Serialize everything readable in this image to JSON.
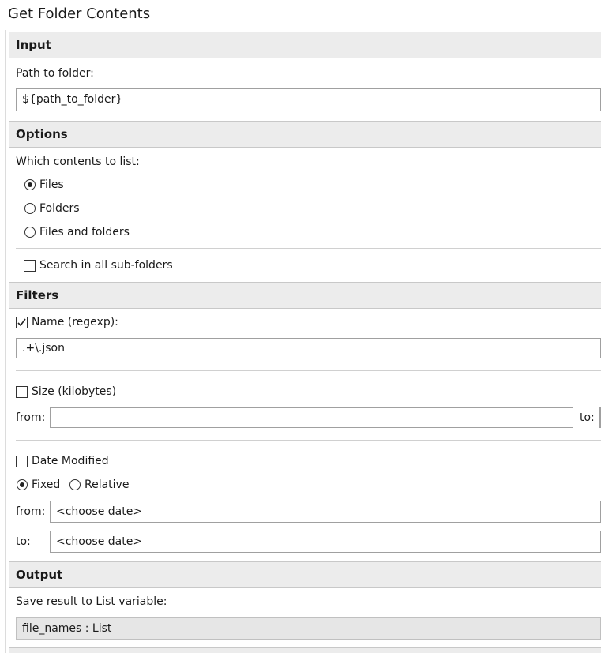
{
  "title": "Get Folder Contents",
  "input": {
    "header": "Input",
    "path_label": "Path to folder:",
    "path_value": "${path_to_folder}"
  },
  "options": {
    "header": "Options",
    "contents_label": "Which contents to list:",
    "radio_files": "Files",
    "radio_folders": "Folders",
    "radio_both": "Files and folders",
    "selected": "Files",
    "subfolders_label": "Search in all sub-folders",
    "subfolders_checked": false
  },
  "filters": {
    "header": "Filters",
    "name_label": "Name (regexp):",
    "name_checked": true,
    "name_value": ".+\\.json",
    "size_label": "Size (kilobytes)",
    "size_checked": false,
    "size_from_label": "from:",
    "size_from_value": "",
    "size_to_label": "to:",
    "date_label": "Date Modified",
    "date_checked": false,
    "fixed_label": "Fixed",
    "relative_label": "Relative",
    "date_mode": "Fixed",
    "date_from_label": "from:",
    "date_from_value": "<choose date>",
    "date_to_label": "to:",
    "date_to_value": "<choose date>"
  },
  "output": {
    "header": "Output",
    "save_label": "Save result to List variable:",
    "save_value": "file_names : List"
  }
}
